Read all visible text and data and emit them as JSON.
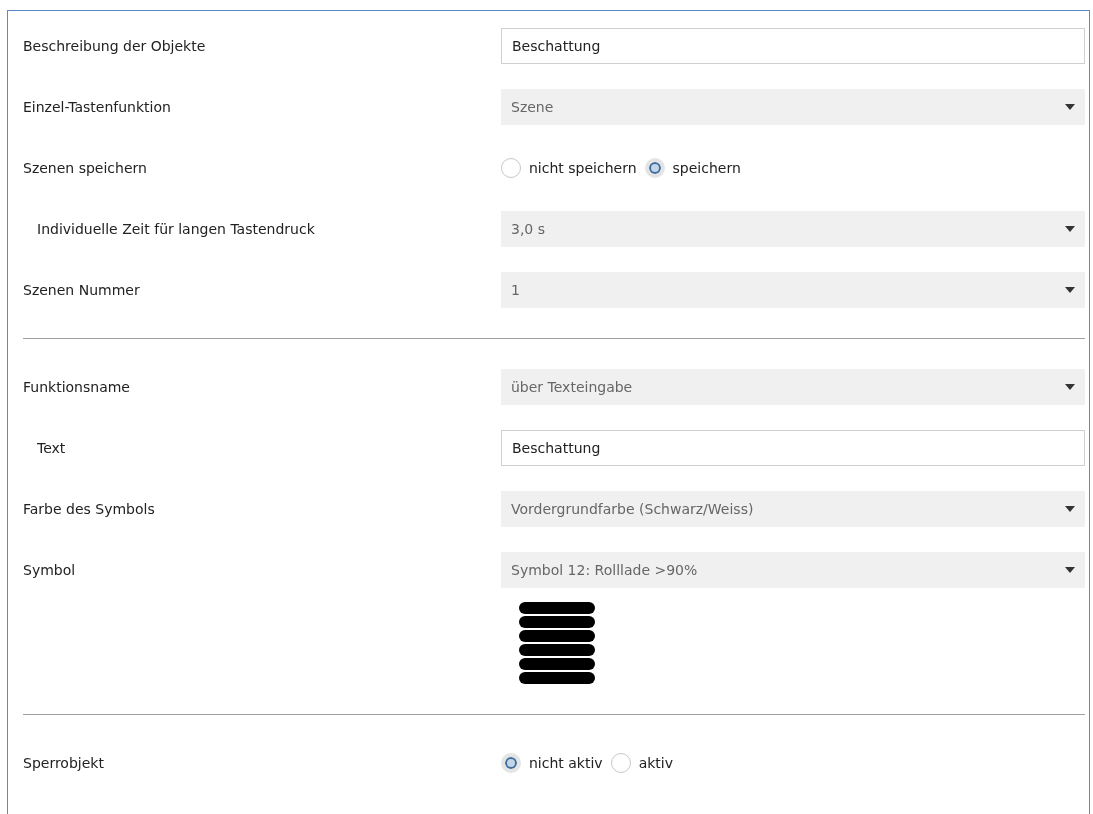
{
  "rows": [
    {
      "kind": "text",
      "label": "Beschreibung der Objekte",
      "indent": false,
      "value": "Beschattung"
    },
    {
      "kind": "select",
      "label": "Einzel-Tastenfunktion",
      "indent": false,
      "value": "Szene"
    },
    {
      "kind": "radio",
      "label": "Szenen speichern",
      "indent": false,
      "options": [
        {
          "label": "nicht speichern",
          "selected": false
        },
        {
          "label": "speichern",
          "selected": true
        }
      ]
    },
    {
      "kind": "select",
      "label": "Individuelle Zeit für langen Tastendruck",
      "indent": true,
      "value": "3,0 s"
    },
    {
      "kind": "select",
      "label": "Szenen Nummer",
      "indent": false,
      "value": "1"
    },
    {
      "kind": "separator"
    },
    {
      "kind": "select",
      "label": "Funktionsname",
      "indent": false,
      "value": "über Texteingabe"
    },
    {
      "kind": "text",
      "label": "Text",
      "indent": true,
      "value": "Beschattung"
    },
    {
      "kind": "select",
      "label": "Farbe des Symbols",
      "indent": false,
      "value": "Vordergrundfarbe (Schwarz/Weiss)"
    },
    {
      "kind": "select",
      "label": "Symbol",
      "indent": false,
      "value": "Symbol 12: Rolllade >90%"
    },
    {
      "kind": "symbol"
    },
    {
      "kind": "separator"
    },
    {
      "kind": "radio",
      "label": "Sperrobjekt",
      "indent": false,
      "options": [
        {
          "label": "nicht aktiv",
          "selected": true
        },
        {
          "label": "aktiv",
          "selected": false
        }
      ]
    }
  ]
}
